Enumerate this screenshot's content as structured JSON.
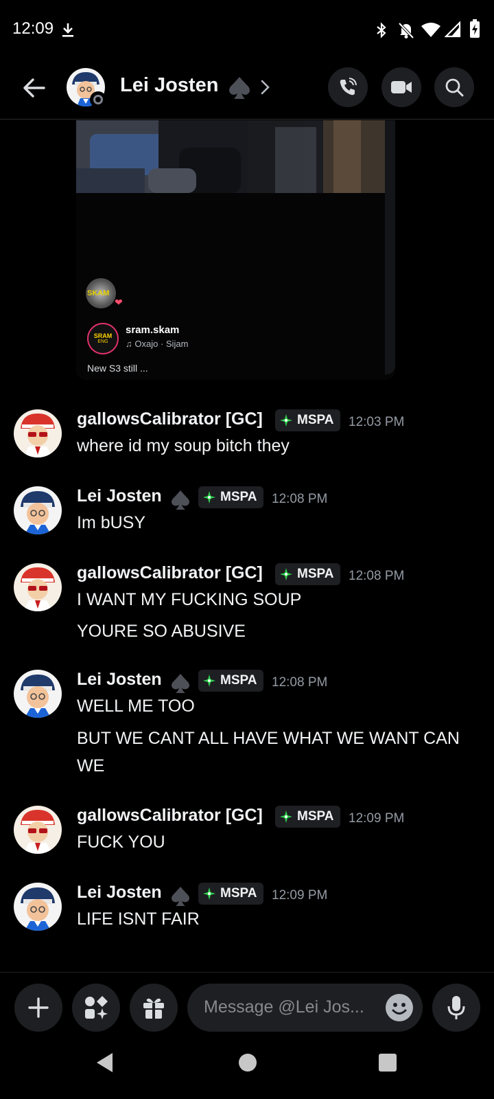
{
  "status_bar": {
    "time": "12:09"
  },
  "header": {
    "name": "Lei Josten"
  },
  "embed": {
    "avatar_text": "SKAM",
    "logo_top": "SRAM",
    "logo_bottom": "ENG",
    "account": "sram.skam",
    "music": "Oxajo · Sijam",
    "caption": "New S3 still ..."
  },
  "messages": [
    {
      "author": "gallowsCalibrator [GC]",
      "tag": "MSPA",
      "time": "12:03 PM",
      "lines": [
        "where id my soup bitch they"
      ]
    },
    {
      "author": "Lei Josten",
      "tag": "MSPA",
      "time": "12:08 PM",
      "lines": [
        "Im bUSY"
      ]
    },
    {
      "author": "gallowsCalibrator [GC]",
      "tag": "MSPA",
      "time": "12:08 PM",
      "lines": [
        "I WANT MY FUCKING SOUP",
        "YOURE SO ABUSIVE"
      ]
    },
    {
      "author": "Lei Josten",
      "tag": "MSPA",
      "time": "12:08 PM",
      "lines": [
        "WELL ME TOO",
        "BUT WE CANT ALL HAVE WHAT WE WANT CAN WE"
      ]
    },
    {
      "author": "gallowsCalibrator [GC]",
      "tag": "MSPA",
      "time": "12:09 PM",
      "lines": [
        "FUCK YOU"
      ]
    },
    {
      "author": "Lei Josten",
      "tag": "MSPA",
      "time": "12:09 PM",
      "lines": [
        "LIFE ISNT FAIR"
      ]
    }
  ],
  "composer": {
    "placeholder": "Message @Lei Jos..."
  },
  "colors": {
    "background": "#000000",
    "tag_background": "#1e1f22",
    "timestamp": "#949ba4",
    "mspa_green": "#2dd14d"
  },
  "icons": {
    "status_bar": [
      "download-icon",
      "bluetooth-icon",
      "bell-off-icon",
      "wifi-icon",
      "signal-icon",
      "battery-icon"
    ],
    "header": [
      "back-arrow-icon",
      "spade-icon",
      "chevron-right-icon",
      "call-icon",
      "video-icon",
      "search-icon"
    ],
    "composer": [
      "plus-icon",
      "apps-icon",
      "gift-icon",
      "emoji-icon",
      "microphone-icon"
    ],
    "navbar": [
      "back-triangle-icon",
      "home-circle-icon",
      "recents-square-icon"
    ]
  }
}
